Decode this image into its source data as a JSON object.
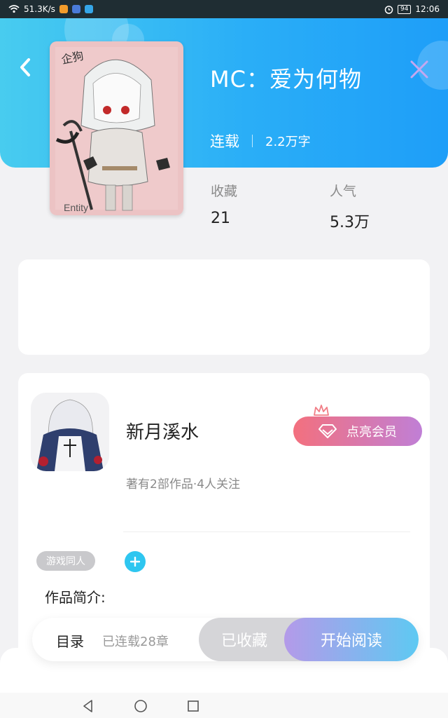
{
  "status_bar": {
    "network_speed": "51.3K/s",
    "battery": "94",
    "time": "12:06"
  },
  "book": {
    "title": "MC：爱为何物",
    "status": "连载",
    "word_count": "2.2万字",
    "cover_text_top": "企狗",
    "cover_text_bottom": "Entity"
  },
  "stats": {
    "favorites_label": "收藏",
    "favorites_value": "21",
    "popularity_label": "人气",
    "popularity_value": "5.3万"
  },
  "author": {
    "name": "新月溪水",
    "summary": "著有2部作品·4人关注",
    "vip_button": "点亮会员"
  },
  "tags": [
    "游戏同人"
  ],
  "intro_label": "作品简介:",
  "action_bar": {
    "toc_label": "目录",
    "chapters": "已连载28章",
    "collected_button": "已收藏",
    "read_button": "开始阅读"
  },
  "colors": {
    "header_start": "#48ccef",
    "header_end": "#1e9ef8",
    "vip_start": "#f3707e",
    "vip_end": "#c07fd6",
    "read_start": "#b49ae9",
    "read_end": "#5ec9f2"
  },
  "icons": [
    "wifi-icon",
    "alarm-icon",
    "back-arrow-icon",
    "close-icon",
    "crown-icon",
    "diamond-icon",
    "plus-icon",
    "nav-back-icon",
    "nav-home-icon",
    "nav-recents-icon"
  ]
}
